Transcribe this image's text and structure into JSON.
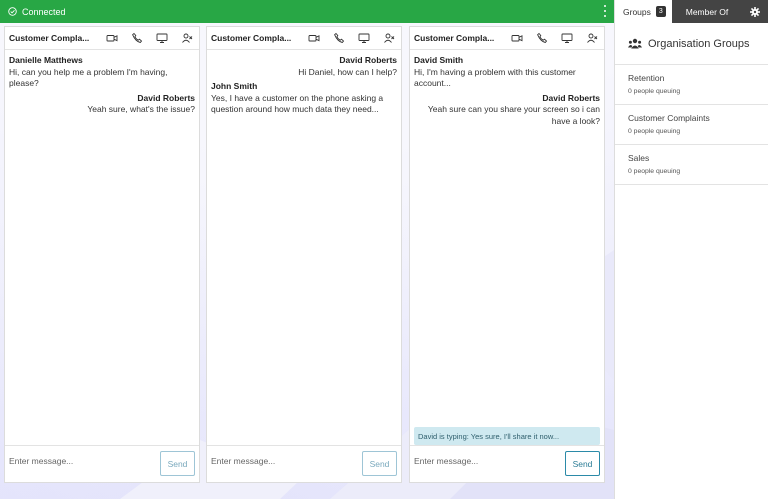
{
  "status": {
    "label": "Connected"
  },
  "colors": {
    "topbar": "#28a745",
    "tab_dark": "#444444",
    "typing_bg": "#cfe9f0",
    "send_border": "#2b8aa8"
  },
  "chats": [
    {
      "title": "Customer Compla...",
      "messages": [
        {
          "from": "Danielle Matthews",
          "text": "Hi, can you help me a problem I'm having, please?",
          "align": "left"
        },
        {
          "from": "David Roberts",
          "text": "Yeah sure, what's the issue?",
          "align": "right"
        }
      ],
      "input_placeholder": "Enter message...",
      "send_label": "Send"
    },
    {
      "title": "Customer Compla...",
      "messages": [
        {
          "from": "David Roberts",
          "text": "Hi Daniel, how can I help?",
          "align": "right"
        },
        {
          "from": "John Smith",
          "text": "Yes, I have a customer on the phone asking a question around how much data they need...",
          "align": "left"
        }
      ],
      "input_placeholder": "Enter message...",
      "send_label": "Send"
    },
    {
      "title": "Customer Compla...",
      "messages": [
        {
          "from": "David Smith",
          "text": "Hi, I'm having a problem with this customer account...",
          "align": "left"
        },
        {
          "from": "David Roberts",
          "text": "Yeah sure can you share your screen so i can have a look?",
          "align": "right"
        }
      ],
      "typing": "David is typing: Yes sure, I'll share it now...",
      "input_placeholder": "Enter message...",
      "send_label": "Send"
    }
  ],
  "panel": {
    "tabs": {
      "groups_label": "Groups",
      "groups_count": "3",
      "member_label": "Member Of"
    },
    "title": "Organisation Groups",
    "groups": [
      {
        "name": "Retention",
        "queue": "0 people queuing"
      },
      {
        "name": "Customer Complaints",
        "queue": "0 people queuing"
      },
      {
        "name": "Sales",
        "queue": "0 people queuing"
      }
    ]
  }
}
